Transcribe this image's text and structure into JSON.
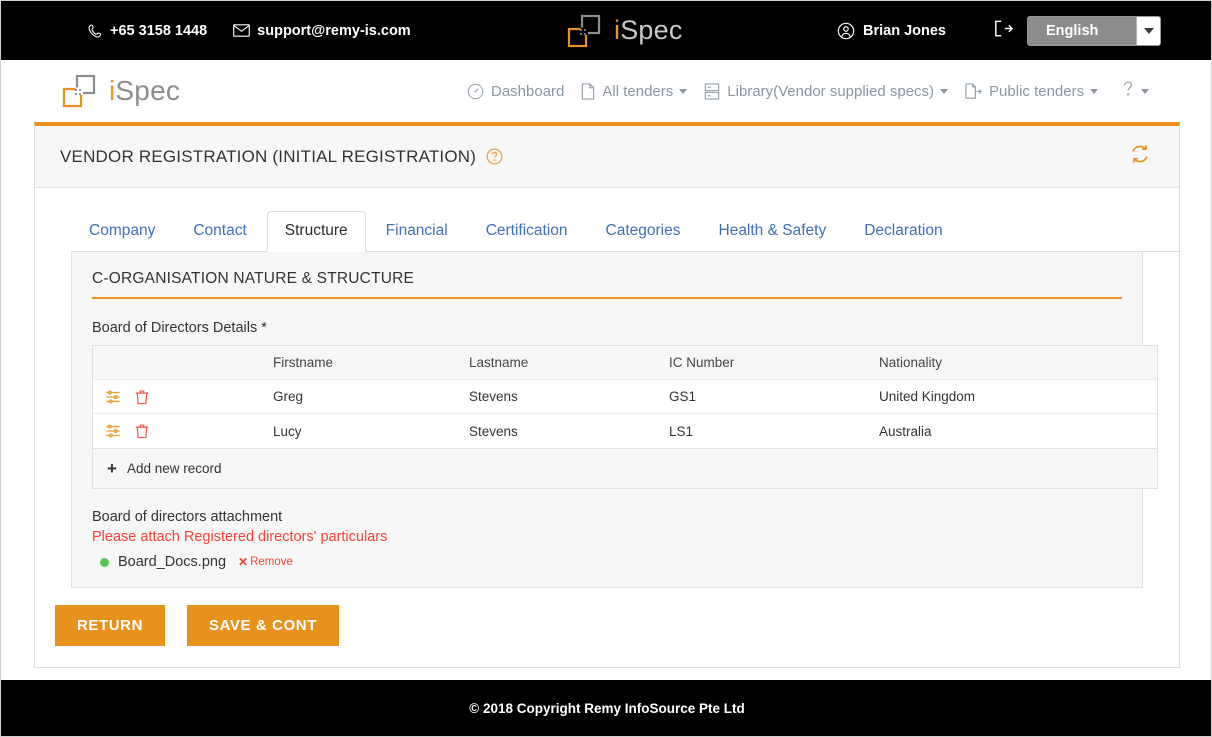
{
  "topbar": {
    "phone_icon": "phone-icon",
    "phone": "+65 3158 1448",
    "mail_icon": "envelope-icon",
    "email": "support@remy-is.com",
    "brand_i": "i",
    "brand_spec": "Spec",
    "user_icon": "user-circle-icon",
    "user_name": "Brian Jones",
    "logout_icon": "logout-icon",
    "language": "English"
  },
  "header": {
    "brand_i": "i",
    "brand_spec": "Spec",
    "nav": [
      {
        "label": "Dashboard",
        "icon": "gauge-icon",
        "caret": false
      },
      {
        "label": "All tenders",
        "icon": "document-icon",
        "caret": true
      },
      {
        "label": "Library(Vendor supplied specs)",
        "icon": "library-icon",
        "caret": true
      },
      {
        "label": "Public tenders",
        "icon": "document-export-icon",
        "caret": true
      }
    ],
    "help_icon": "question-mark-icon"
  },
  "page_header": {
    "title": "VENDOR REGISTRATION (INITIAL REGISTRATION)",
    "help_icon": "question-circle-icon",
    "refresh_icon": "refresh-icon"
  },
  "tabs": [
    {
      "label": "Company",
      "active": false
    },
    {
      "label": "Contact",
      "active": false
    },
    {
      "label": "Structure",
      "active": true
    },
    {
      "label": "Financial",
      "active": false
    },
    {
      "label": "Certification",
      "active": false
    },
    {
      "label": "Categories",
      "active": false
    },
    {
      "label": "Health & Safety",
      "active": false
    },
    {
      "label": "Declaration",
      "active": false
    }
  ],
  "section": {
    "title": "C-ORGANISATION NATURE & STRUCTURE",
    "field_label": "Board of Directors Details *"
  },
  "grid": {
    "columns": [
      "",
      "Firstname",
      "Lastname",
      "IC Number",
      "Nationality"
    ],
    "rows": [
      {
        "firstname": "Greg",
        "lastname": "Stevens",
        "ic": "GS1",
        "nationality": "United Kingdom",
        "edit_icon": "sliders-icon",
        "delete_icon": "trash-icon"
      },
      {
        "firstname": "Lucy",
        "lastname": "Stevens",
        "ic": "LS1",
        "nationality": "Australia",
        "edit_icon": "sliders-icon",
        "delete_icon": "trash-icon"
      }
    ],
    "add_label": "Add new record",
    "add_icon": "plus-icon"
  },
  "attachment": {
    "label": "Board of directors attachment",
    "warning": "Please attach Registered directors' particulars",
    "file_name": "Board_Docs.png",
    "remove_label": "Remove",
    "remove_icon": "close-x-icon",
    "status_color": "#57c457"
  },
  "buttons": {
    "return": "RETURN",
    "save": "SAVE & CONT"
  },
  "footer": {
    "copyright": "© 2018 Copyright  Remy InfoSource Pte Ltd"
  },
  "colors": {
    "accent": "#e8921e",
    "link": "#3f6fb5",
    "danger": "#f44336",
    "bar": "#000000"
  }
}
